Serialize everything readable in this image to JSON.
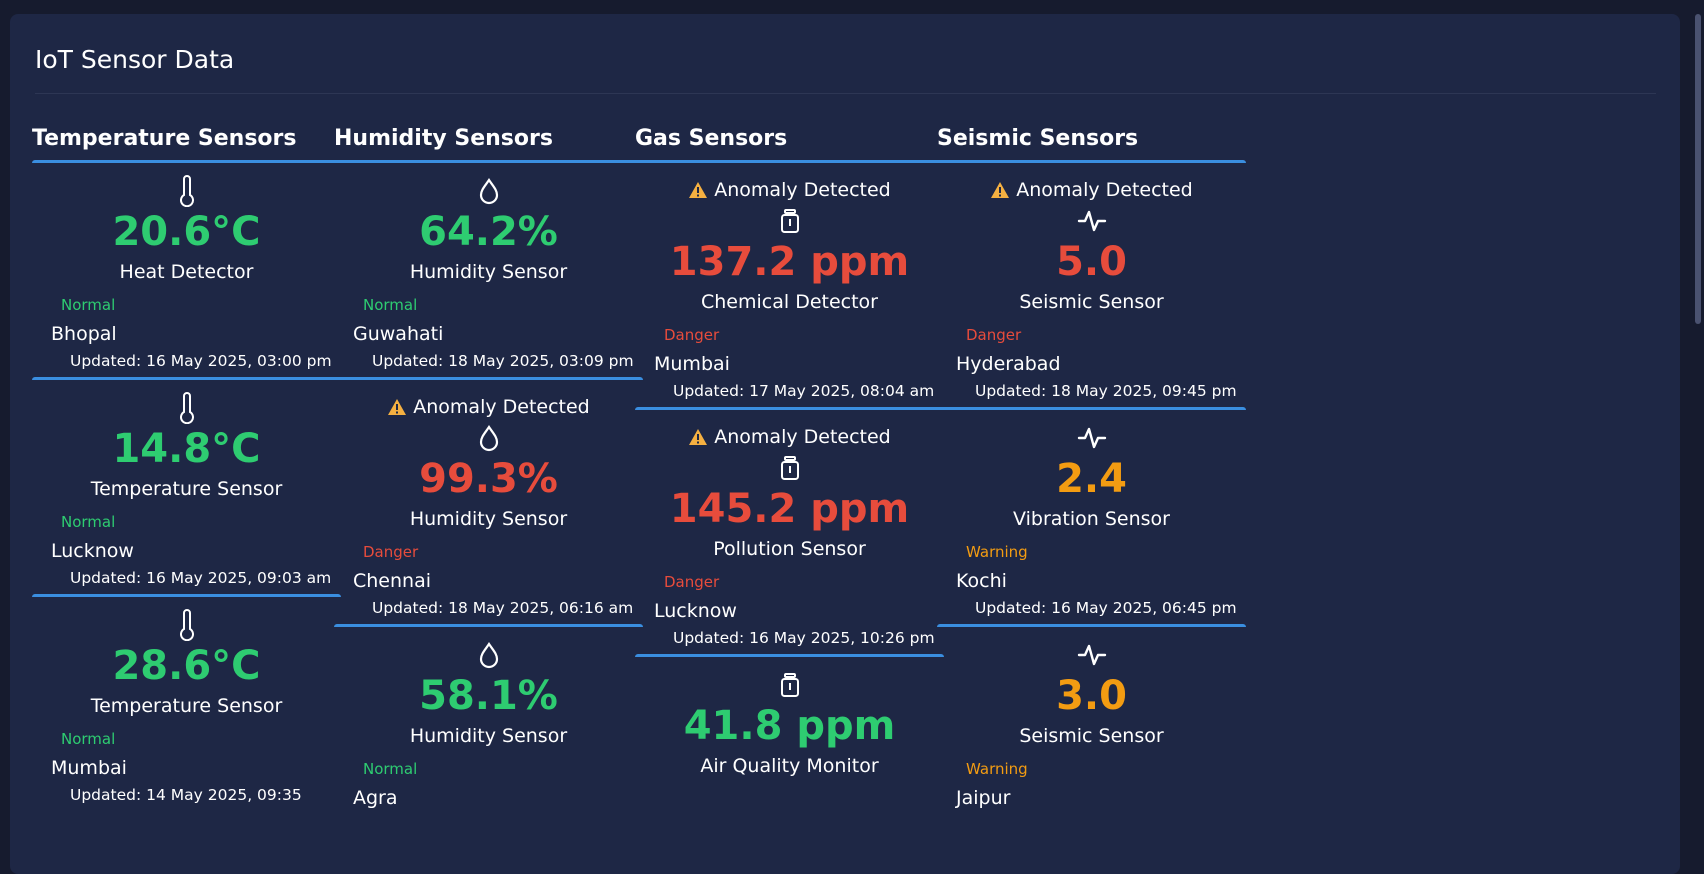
{
  "title": "IoT Sensor Data",
  "colors": {
    "normal": "#2ecc71",
    "danger": "#e74c3c",
    "warning": "#f39c12",
    "accent": "#3a8ee0"
  },
  "columns": [
    {
      "title": "Temperature Sensors",
      "icon": "thermometer-icon",
      "cards": [
        {
          "anomaly": "",
          "value": "20.6°C",
          "name": "Heat Detector",
          "status": "Normal",
          "location": "Bhopal",
          "updated": "Updated: 16 May 2025, 03:00 pm"
        },
        {
          "anomaly": "",
          "value": "14.8°C",
          "name": "Temperature Sensor",
          "status": "Normal",
          "location": "Lucknow",
          "updated": "Updated: 16 May 2025, 09:03 am"
        },
        {
          "anomaly": "",
          "value": "28.6°C",
          "name": "Temperature Sensor",
          "status": "Normal",
          "location": "Mumbai",
          "updated": "Updated: 14 May 2025, 09:35"
        }
      ]
    },
    {
      "title": "Humidity Sensors",
      "icon": "droplet-icon",
      "cards": [
        {
          "anomaly": "",
          "value": "64.2%",
          "name": "Humidity Sensor",
          "status": "Normal",
          "location": "Guwahati",
          "updated": "Updated: 18 May 2025, 03:09 pm"
        },
        {
          "anomaly": "Anomaly Detected",
          "value": "99.3%",
          "name": "Humidity Sensor",
          "status": "Danger",
          "location": "Chennai",
          "updated": "Updated: 18 May 2025, 06:16 am"
        },
        {
          "anomaly": "",
          "value": "58.1%",
          "name": "Humidity Sensor",
          "status": "Normal",
          "location": "Agra",
          "updated": ""
        }
      ]
    },
    {
      "title": "Gas Sensors",
      "icon": "gas-canister-icon",
      "cards": [
        {
          "anomaly": "Anomaly Detected",
          "value": "137.2 ppm",
          "name": "Chemical Detector",
          "status": "Danger",
          "location": "Mumbai",
          "updated": "Updated: 17 May 2025, 08:04 am"
        },
        {
          "anomaly": "Anomaly Detected",
          "value": "145.2 ppm",
          "name": "Pollution Sensor",
          "status": "Danger",
          "location": "Lucknow",
          "updated": "Updated: 16 May 2025, 10:26 pm"
        },
        {
          "anomaly": "",
          "value": "41.8 ppm",
          "name": "Air Quality Monitor",
          "status": "",
          "location": "",
          "updated": ""
        }
      ]
    },
    {
      "title": "Seismic Sensors",
      "icon": "pulse-icon",
      "cards": [
        {
          "anomaly": "Anomaly Detected",
          "value": "5.0",
          "name": "Seismic Sensor",
          "status": "Danger",
          "location": "Hyderabad",
          "updated": "Updated: 18 May 2025, 09:45 pm"
        },
        {
          "anomaly": "",
          "value": "2.4",
          "name": "Vibration Sensor",
          "status": "Warning",
          "location": "Kochi",
          "updated": "Updated: 16 May 2025, 06:45 pm"
        },
        {
          "anomaly": "",
          "value": "3.0",
          "name": "Seismic Sensor",
          "status": "Warning",
          "location": "Jaipur",
          "updated": ""
        }
      ]
    }
  ]
}
